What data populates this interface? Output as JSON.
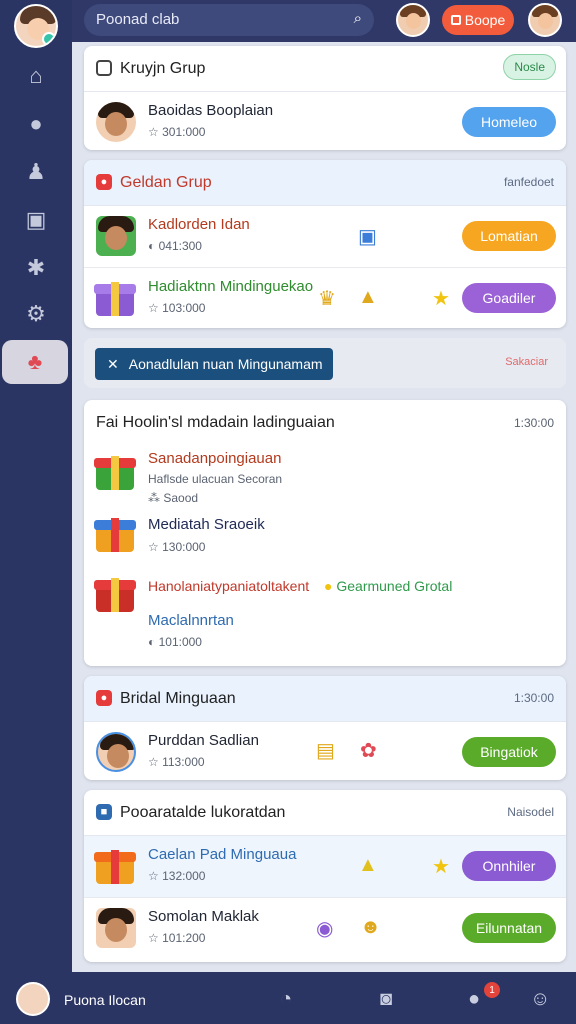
{
  "topbar": {
    "search_placeholder": "Poonad clab",
    "button_label": "Boope"
  },
  "groups": [
    {
      "title": "Kruyjn Grup",
      "right_badge": "Nosle",
      "rows": [
        {
          "name": "Baoidas Booplaian",
          "meta": "301:000",
          "action": "Homeleo",
          "action_color": "#53a3ef"
        }
      ]
    },
    {
      "title": "Geldan Grup",
      "right_text": "fanfedoet",
      "rows": [
        {
          "name": "Kadlorden Idan",
          "meta": "041:300",
          "action": "Lomatian",
          "action_color": "#f6a620"
        },
        {
          "name": "Hadiaktnn Mindinguekao",
          "meta": "103:000",
          "action": "Goadiler",
          "action_color": "#9a62d6"
        }
      ]
    }
  ],
  "banner": {
    "label": "Aonadlulan nuan Mingunamam",
    "right": "Sakaciar"
  },
  "big_card": {
    "title": "Fai Hoolin'sl mdadain ladinguaian",
    "time": "1:30:00",
    "items": [
      {
        "name": "Sanadanpoingiauan",
        "sub": "Haflsde ulacuan Secoran",
        "meta": "Saood"
      },
      {
        "name": "Mediatah Sraoeik",
        "meta": "130:000"
      },
      {
        "name": "Hanolaniatypaniatoltakent",
        "tag": "Gearmuned Grotal"
      },
      {
        "name": "Maclalnnrtan",
        "meta": "101:000"
      }
    ]
  },
  "group3": {
    "title": "Bridal Minguaan",
    "time": "1:30:00",
    "row": {
      "name": "Purddan Sadlian",
      "meta": "113:000",
      "action": "Bingatiok",
      "action_color": "#5bab2b"
    }
  },
  "group4": {
    "title": "Pooaratalde lukoratdan",
    "right": "Naisodel",
    "rows": [
      {
        "name": "Caelan Pad Minguaua",
        "meta": "132:000",
        "action": "Onnhiler",
        "action_color": "#8a5bd2"
      },
      {
        "name": "Somolan Maklak",
        "meta": "101:200",
        "action": "Eilunnatan",
        "action_color": "#5bab2b"
      }
    ]
  },
  "bottombar": {
    "name": "Puona Ilocan",
    "notifications": "1"
  }
}
